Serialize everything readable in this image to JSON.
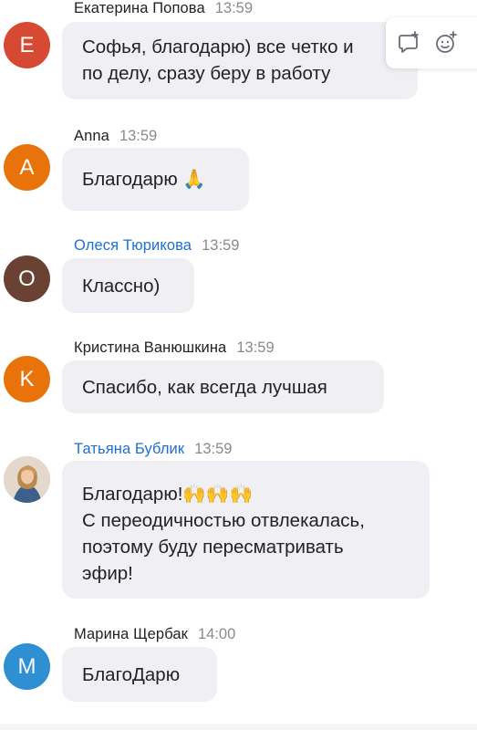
{
  "messages": [
    {
      "author": "Екатерина Попова",
      "time": "13:59",
      "avatar_letter": "E",
      "avatar_color": "#d64a34",
      "lines": [
        "Софья, благодарю) все четко и",
        "по делу, сразу беру в работу"
      ]
    },
    {
      "author": "Anna",
      "time": "13:59",
      "avatar_letter": "A",
      "avatar_color": "#e8730a",
      "lines": [
        "Благодарю 🙏"
      ]
    },
    {
      "author": "Олеся Тюрикова",
      "time": "13:59",
      "avatar_letter": "O",
      "avatar_color": "#6a4234",
      "author_color": "#1d6fd6",
      "lines": [
        "Классно)"
      ]
    },
    {
      "author": "Кристина Ванюшкина",
      "time": "13:59",
      "avatar_letter": "K",
      "avatar_color": "#e8730a",
      "lines": [
        "Спасибо, как всегда лучшая"
      ]
    },
    {
      "author": "Татьяна Бублик",
      "time": "13:59",
      "author_color": "#1d6fd6",
      "lines": [
        "Благодарю!🙌🙌🙌",
        "С переодичностью отвлекалась,",
        "поэтому буду пересматривать",
        "эфир!"
      ]
    },
    {
      "author": "Марина Щербак",
      "time": "14:00",
      "avatar_letter": "M",
      "avatar_color": "#2f8fd3",
      "lines": [
        "БлагоДарю"
      ]
    }
  ],
  "hover_actions": {
    "reply_icon": "reply-in-thread-icon",
    "reaction_icon": "add-reaction-icon"
  },
  "colors": {
    "bubble": "#f0f0f4",
    "link_author": "#1d6fd6"
  }
}
